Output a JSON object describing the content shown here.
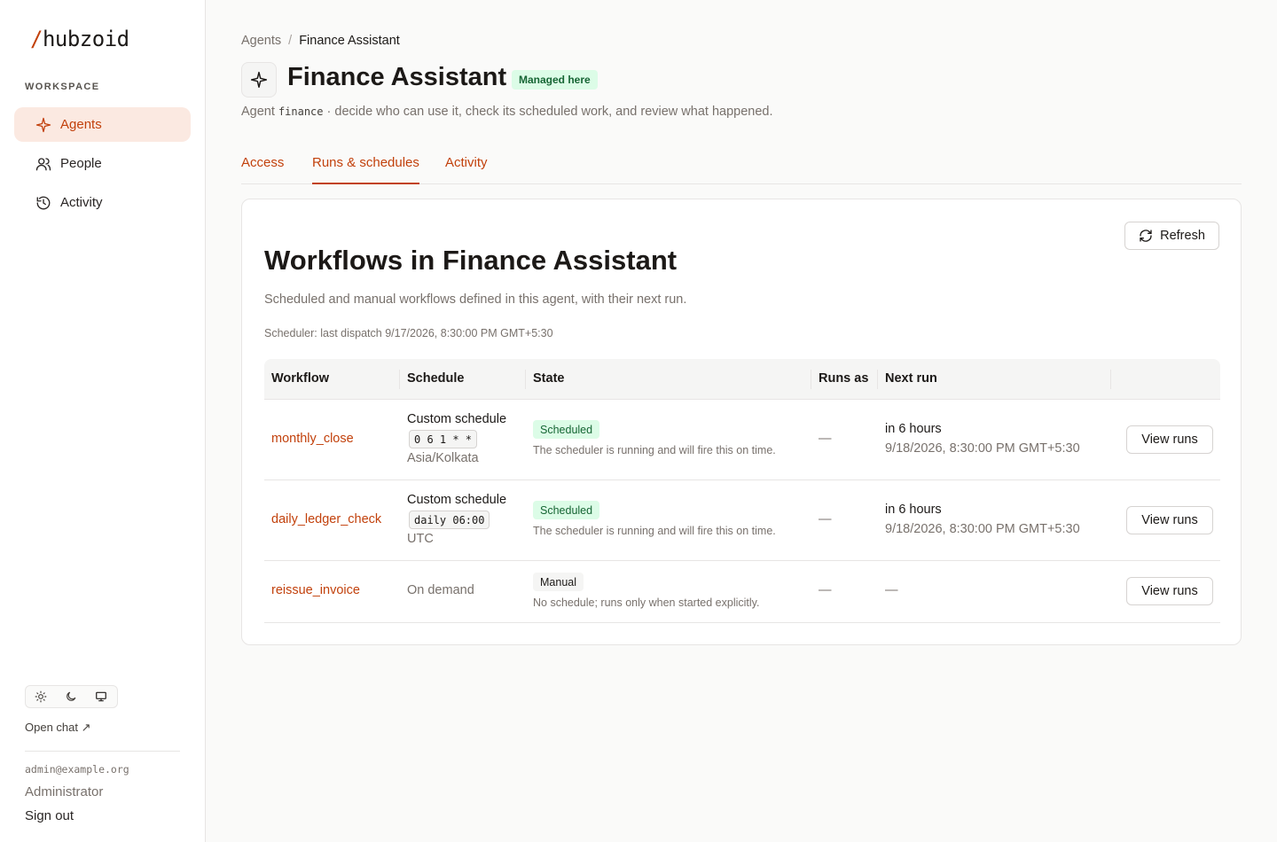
{
  "brand": {
    "slash": "/",
    "name": "hubzoid",
    "accent": "#c2410c"
  },
  "sidebar": {
    "section_label": "WORKSPACE",
    "items": [
      {
        "label": "Agents",
        "icon": "sparkle-icon",
        "active": true
      },
      {
        "label": "People",
        "icon": "users-icon",
        "active": false
      },
      {
        "label": "Activity",
        "icon": "history-icon",
        "active": false
      }
    ],
    "theme_options": [
      "sun-icon",
      "moon-icon",
      "monitor-icon"
    ],
    "open_chat": "Open chat ↗",
    "user_email": "admin@example.org",
    "user_role": "Administrator",
    "sign_out": "Sign out"
  },
  "header": {
    "breadcrumb": {
      "root": "Agents",
      "separator": "/",
      "current": "Finance Assistant"
    },
    "title": "Finance Assistant",
    "badge": "Managed here",
    "subtitle_prefix": "Agent",
    "agent_id": "finance",
    "subtitle_suffix": "· decide who can use it, check its scheduled work, and review what happened."
  },
  "tabs": [
    {
      "label": "Access",
      "active": false
    },
    {
      "label": "Runs & schedules",
      "active": true
    },
    {
      "label": "Activity",
      "active": false
    }
  ],
  "card": {
    "refresh_label": "Refresh",
    "title": "Workflows in Finance Assistant",
    "description": "Scheduled and manual workflows defined in this agent, with their next run.",
    "scheduler_note": "Scheduler: last dispatch 9/17/2026, 8:30:00 PM GMT+5:30",
    "table": {
      "columns": [
        "Workflow",
        "Schedule",
        "State",
        "Runs as",
        "Next run"
      ],
      "rows": [
        {
          "workflow": "monthly_close",
          "schedule_title": "Custom schedule",
          "cron": "0 6 1 * *",
          "timezone": "Asia/Kolkata",
          "state": "Scheduled",
          "state_note": "The scheduler is running and will fire this on time.",
          "runs_as": "—",
          "next_relative": "in 6 hours",
          "next_absolute": "9/18/2026, 8:30:00 PM GMT+5:30",
          "action": "View runs"
        },
        {
          "workflow": "daily_ledger_check",
          "schedule_title": "Custom schedule",
          "cron": "daily 06:00",
          "timezone": "UTC",
          "state": "Scheduled",
          "state_note": "The scheduler is running and will fire this on time.",
          "runs_as": "—",
          "next_relative": "in 6 hours",
          "next_absolute": "9/18/2026, 8:30:00 PM GMT+5:30",
          "action": "View runs"
        },
        {
          "workflow": "reissue_invoice",
          "schedule_title": "On demand",
          "state": "Manual",
          "state_note": "No schedule; runs only when started explicitly.",
          "runs_as": "—",
          "next_relative": "—",
          "action": "View runs"
        }
      ]
    }
  }
}
